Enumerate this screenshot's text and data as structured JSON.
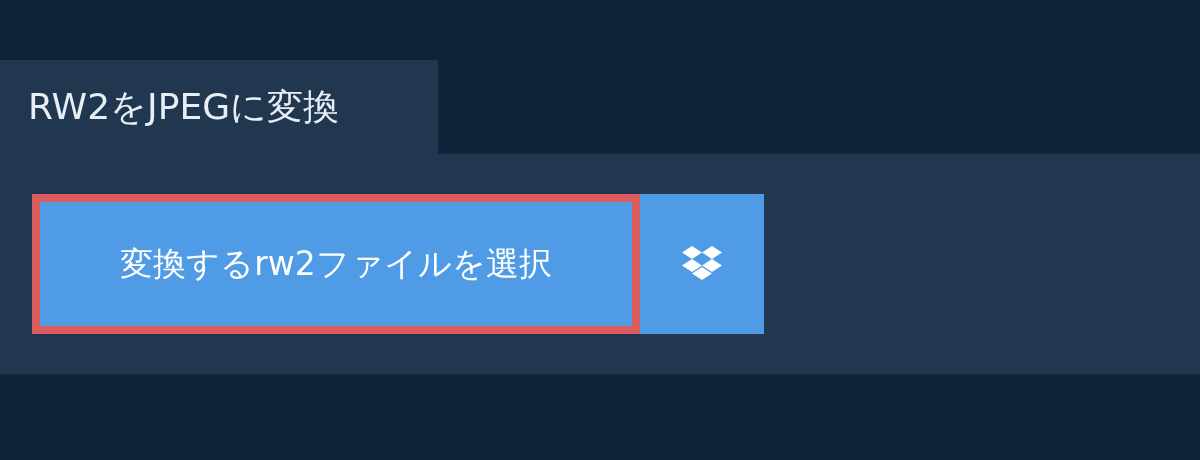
{
  "tab": {
    "title": "RW2をJPEGに変換"
  },
  "upload": {
    "label": "変換するrw2ファイルを選択"
  }
}
